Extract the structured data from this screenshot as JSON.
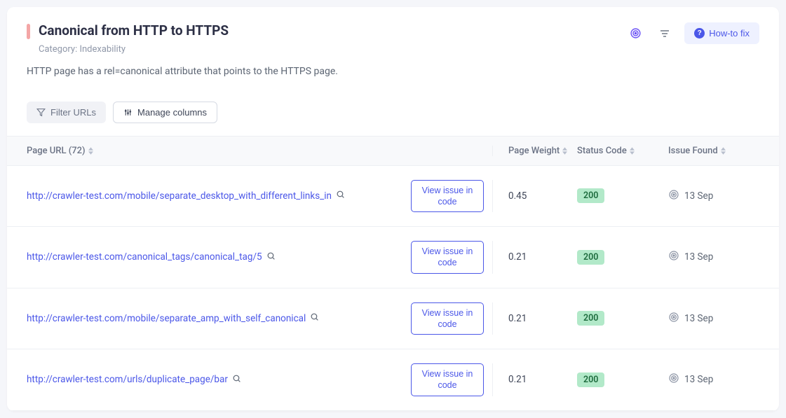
{
  "header": {
    "title": "Canonical from HTTP to HTTPS",
    "category_prefix": "Category: ",
    "category_value": "Indexability",
    "description": "HTTP page has a rel=canonical attribute that points to the HTTPS page.",
    "howto_label": "How-to fix"
  },
  "toolbar": {
    "filter_label": "Filter URLs",
    "manage_label": "Manage columns"
  },
  "columns": {
    "url_label": "Page URL (72)",
    "weight_label": "Page Weight",
    "status_label": "Status Code",
    "found_label": "Issue Found"
  },
  "view_issue_label": "View issue in code",
  "rows": [
    {
      "url": "http://crawler-test.com/mobile/separate_desktop_with_different_links_in",
      "weight": "0.45",
      "status": "200",
      "found": "13 Sep"
    },
    {
      "url": "http://crawler-test.com/canonical_tags/canonical_tag/5",
      "weight": "0.21",
      "status": "200",
      "found": "13 Sep"
    },
    {
      "url": "http://crawler-test.com/mobile/separate_amp_with_self_canonical",
      "weight": "0.21",
      "status": "200",
      "found": "13 Sep"
    },
    {
      "url": "http://crawler-test.com/urls/duplicate_page/bar",
      "weight": "0.21",
      "status": "200",
      "found": "13 Sep"
    }
  ]
}
